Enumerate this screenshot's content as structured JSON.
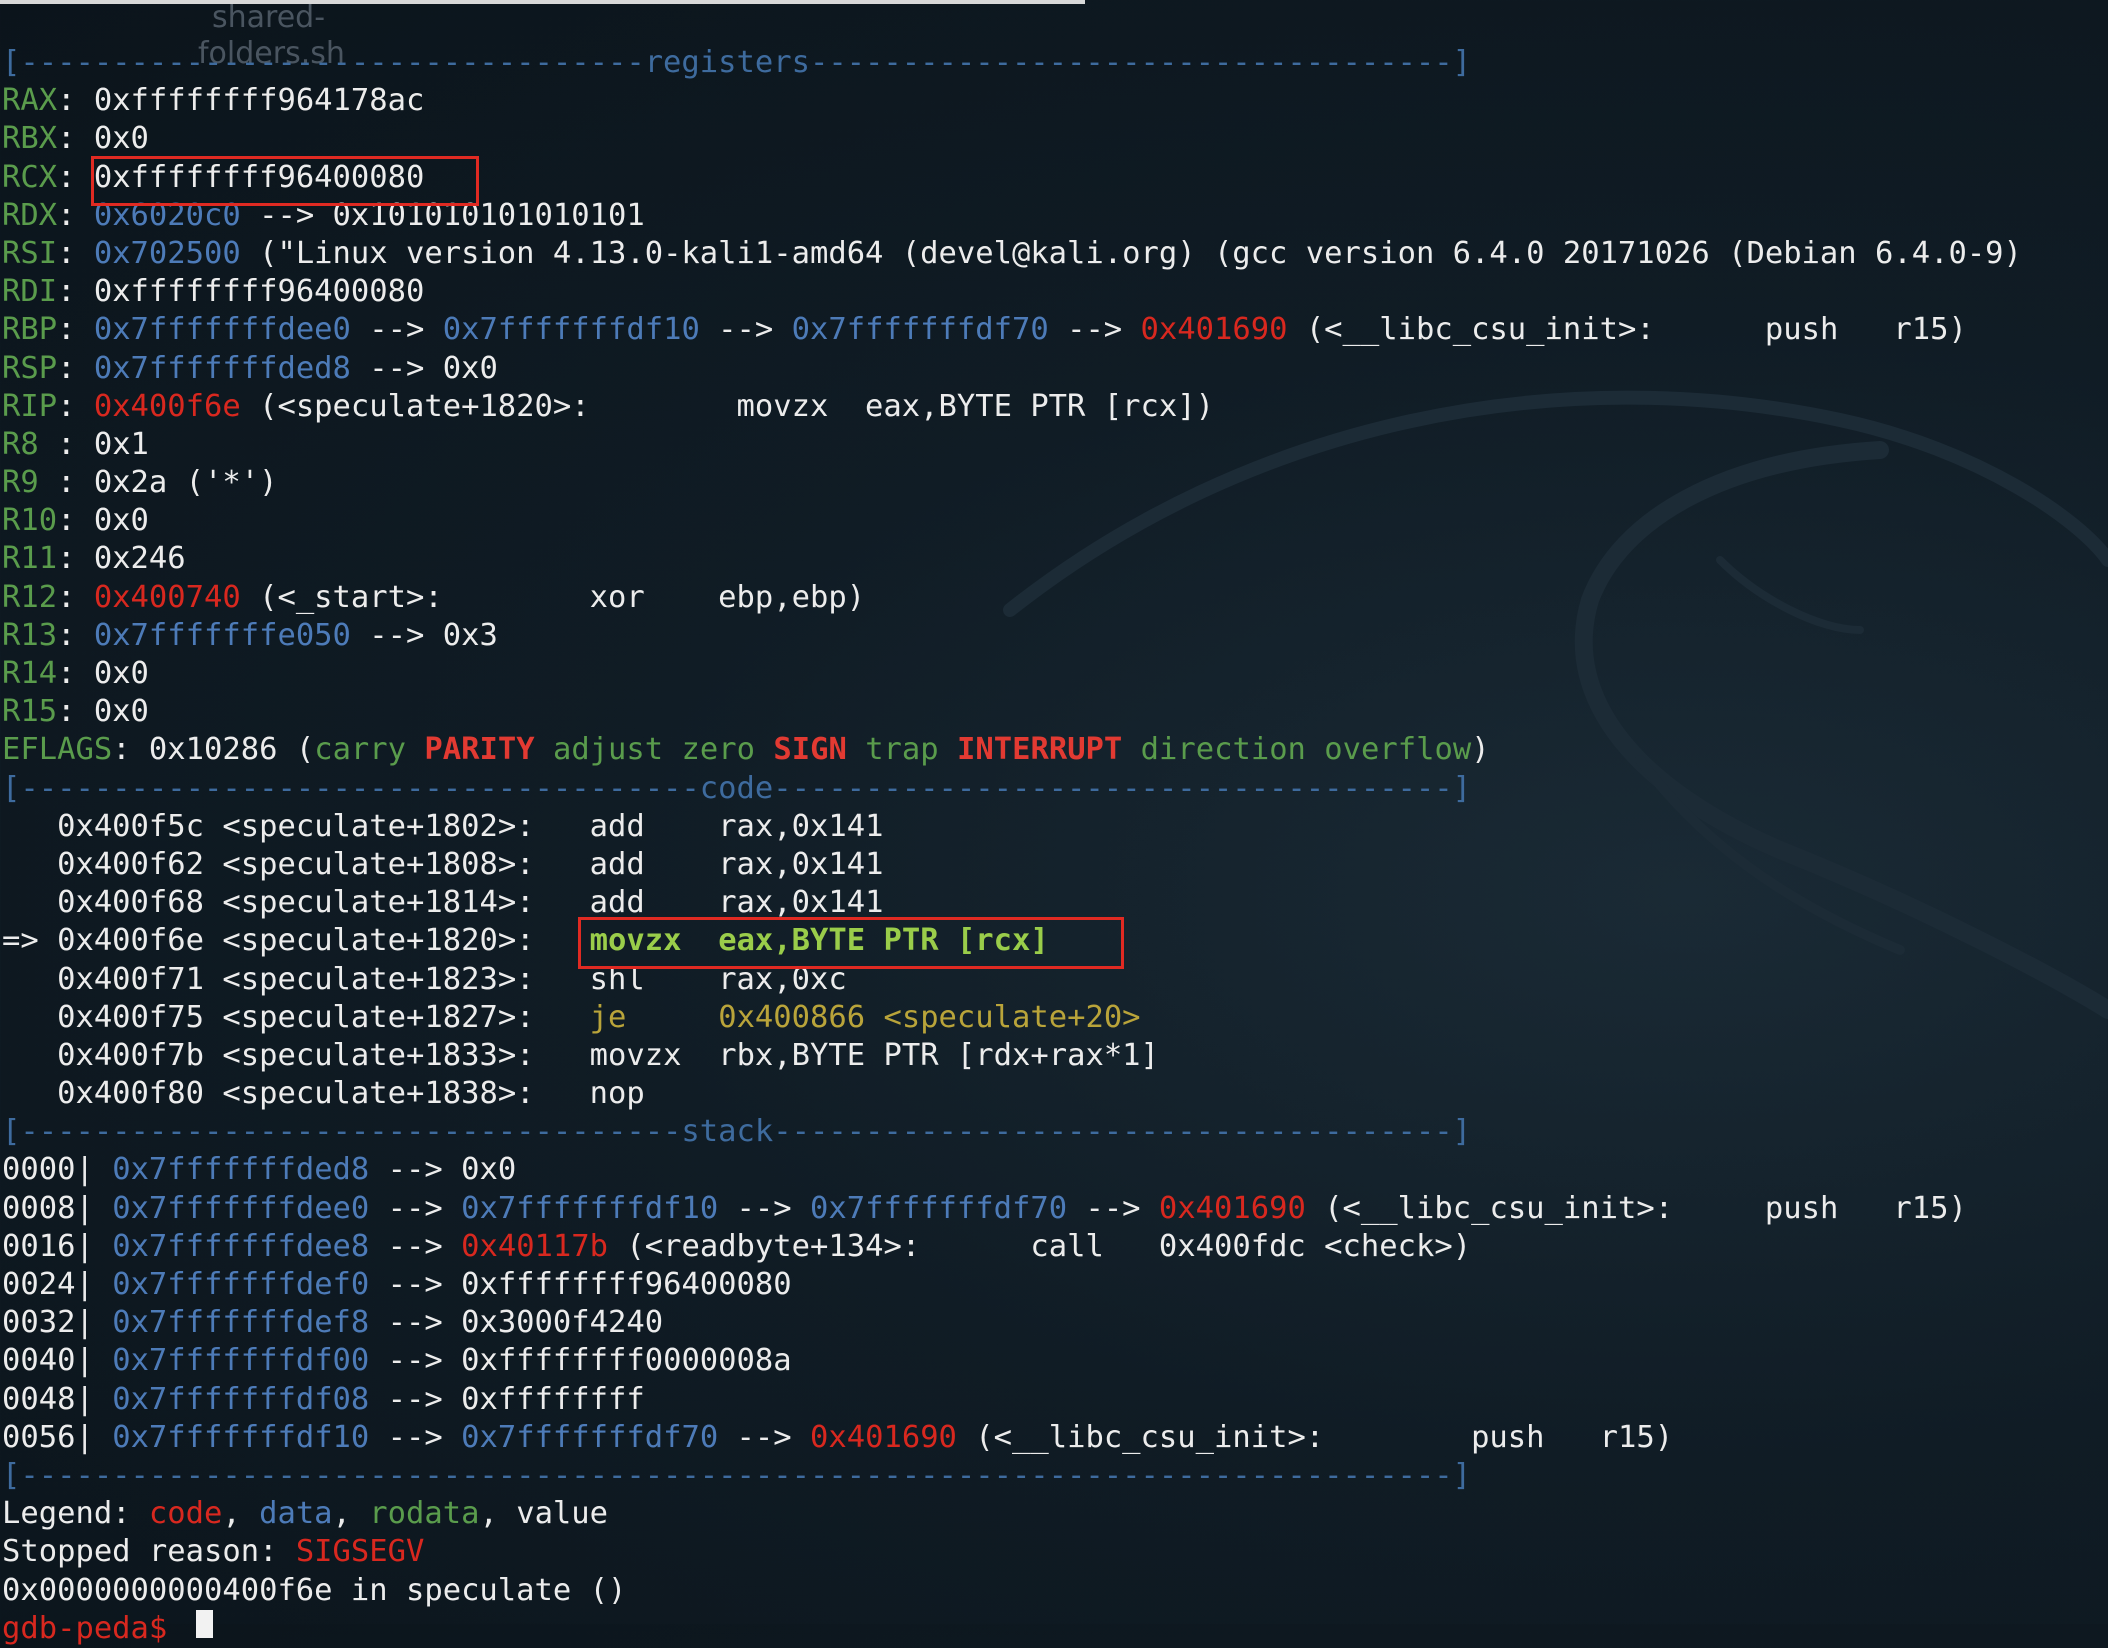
{
  "desktop": {
    "ghost_text": [
      "shared-",
      "folders.sh"
    ]
  },
  "colors": {
    "code": "#d8281f",
    "data": "#4d7bb8",
    "rodata": "#5a9c4c",
    "value": "#ececec"
  },
  "sections": {
    "registers": "[----------------------------------registers-----------------------------------]",
    "code": "[-------------------------------------code-------------------------------------]",
    "stack": "[------------------------------------stack-------------------------------------]",
    "end": "[------------------------------------------------------------------------------]"
  },
  "registers": [
    {
      "name": "RAX",
      "sep": ": ",
      "value": "0xffffffff964178ac"
    },
    {
      "name": "RBX",
      "sep": ": ",
      "value": "0x0"
    },
    {
      "name": "RCX",
      "sep": ": ",
      "value": "0xffffffff96400080"
    },
    {
      "name": "RDX",
      "sep": ": ",
      "addr": "0x6020c0",
      "rest": " --> 0x101010101010101"
    },
    {
      "name": "RSI",
      "sep": ": ",
      "addr": "0x702500",
      "rest": " (\"Linux version 4.13.0-kali1-amd64 (devel@kali.org) (gcc version 6.4.0 20171026 (Debian 6.4.0-9)"
    },
    {
      "name": "RDI",
      "sep": ": ",
      "value": "0xffffffff96400080"
    },
    {
      "name": "RBP",
      "sep": ": ",
      "chain": [
        "0x7fffffffdee0",
        "0x7fffffffdf10",
        "0x7fffffffdf70"
      ],
      "code": "0x401690",
      "rest": " (<__libc_csu_init>:      push   r15)"
    },
    {
      "name": "RSP",
      "sep": ": ",
      "addr": "0x7fffffffded8",
      "rest": " --> 0x0"
    },
    {
      "name": "RIP",
      "sep": ": ",
      "code": "0x400f6e",
      "rest": " (<speculate+1820>:        movzx  eax,BYTE PTR [rcx])"
    },
    {
      "name": "R8",
      "sep": " : ",
      "value": "0x1"
    },
    {
      "name": "R9",
      "sep": " : ",
      "value": "0x2a ('*')"
    },
    {
      "name": "R10",
      "sep": ": ",
      "value": "0x0"
    },
    {
      "name": "R11",
      "sep": ": ",
      "value": "0x246"
    },
    {
      "name": "R12",
      "sep": ": ",
      "code": "0x400740",
      "rest": " (<_start>:        xor    ebp,ebp)"
    },
    {
      "name": "R13",
      "sep": ": ",
      "addr": "0x7fffffffe050",
      "rest": " --> 0x3"
    },
    {
      "name": "R14",
      "sep": ": ",
      "value": "0x0"
    },
    {
      "name": "R15",
      "sep": ": ",
      "value": "0x0"
    }
  ],
  "eflags": {
    "label": "EFLAGS",
    "value": "0x10286",
    "flags": [
      {
        "t": "carry",
        "set": false
      },
      {
        "t": "PARITY",
        "set": true
      },
      {
        "t": "adjust",
        "set": false
      },
      {
        "t": "zero",
        "set": false
      },
      {
        "t": "SIGN",
        "set": true
      },
      {
        "t": "trap",
        "set": false
      },
      {
        "t": "INTERRUPT",
        "set": true
      },
      {
        "t": "direction",
        "set": false
      },
      {
        "t": "overflow",
        "set": false
      }
    ]
  },
  "code": [
    {
      "arrow": "   ",
      "addr": "0x400f5c",
      "sym": "<speculate+1802>:",
      "op": "add",
      "args": "rax,0x141"
    },
    {
      "arrow": "   ",
      "addr": "0x400f62",
      "sym": "<speculate+1808>:",
      "op": "add",
      "args": "rax,0x141"
    },
    {
      "arrow": "   ",
      "addr": "0x400f68",
      "sym": "<speculate+1814>:",
      "op": "add",
      "args": "rax,0x141"
    },
    {
      "arrow": "=> ",
      "addr": "0x400f6e",
      "sym": "<speculate+1820>:",
      "op": "movzx",
      "args": "eax,BYTE PTR [rcx]",
      "current": true
    },
    {
      "arrow": "   ",
      "addr": "0x400f71",
      "sym": "<speculate+1823>:",
      "op": "shl",
      "args": "rax,0xc"
    },
    {
      "arrow": "   ",
      "addr": "0x400f75",
      "sym": "<speculate+1827>:",
      "op": "je",
      "args": "0x400866 <speculate+20>",
      "jump": true
    },
    {
      "arrow": "   ",
      "addr": "0x400f7b",
      "sym": "<speculate+1833>:",
      "op": "movzx",
      "args": "rbx,BYTE PTR [rdx+rax*1]"
    },
    {
      "arrow": "   ",
      "addr": "0x400f80",
      "sym": "<speculate+1838>:",
      "op": "nop",
      "args": ""
    }
  ],
  "stack": [
    {
      "off": "0000|",
      "chain": [
        "0x7fffffffded8"
      ],
      "rest": " --> 0x0"
    },
    {
      "off": "0008|",
      "chain": [
        "0x7fffffffdee0",
        "0x7fffffffdf10",
        "0x7fffffffdf70"
      ],
      "code": "0x401690",
      "rest": " (<__libc_csu_init>:     push   r15)"
    },
    {
      "off": "0016|",
      "chain": [
        "0x7fffffffdee8"
      ],
      "code": "0x40117b",
      "rest": " (<readbyte+134>:      call   0x400fdc <check>)"
    },
    {
      "off": "0024|",
      "chain": [
        "0x7fffffffdef0"
      ],
      "rest": " --> 0xffffffff96400080"
    },
    {
      "off": "0032|",
      "chain": [
        "0x7fffffffdef8"
      ],
      "rest": " --> 0x3000f4240"
    },
    {
      "off": "0040|",
      "chain": [
        "0x7fffffffdf00"
      ],
      "rest": " --> 0xffffffff0000008a"
    },
    {
      "off": "0048|",
      "chain": [
        "0x7fffffffdf08"
      ],
      "rest": " --> 0xffffffff"
    },
    {
      "off": "0056|",
      "chain": [
        "0x7fffffffdf10",
        "0x7fffffffdf70"
      ],
      "code": "0x401690",
      "rest": " (<__libc_csu_init>:        push   r15)"
    }
  ],
  "legend": {
    "label": "Legend: ",
    "code": "code",
    "data": "data",
    "rodata": "rodata",
    "value": "value"
  },
  "stopped": {
    "label": "Stopped reason: ",
    "reason": "SIGSEGV"
  },
  "frame": "0x0000000000400f6e in speculate ()",
  "prompt": "gdb-peda$ "
}
